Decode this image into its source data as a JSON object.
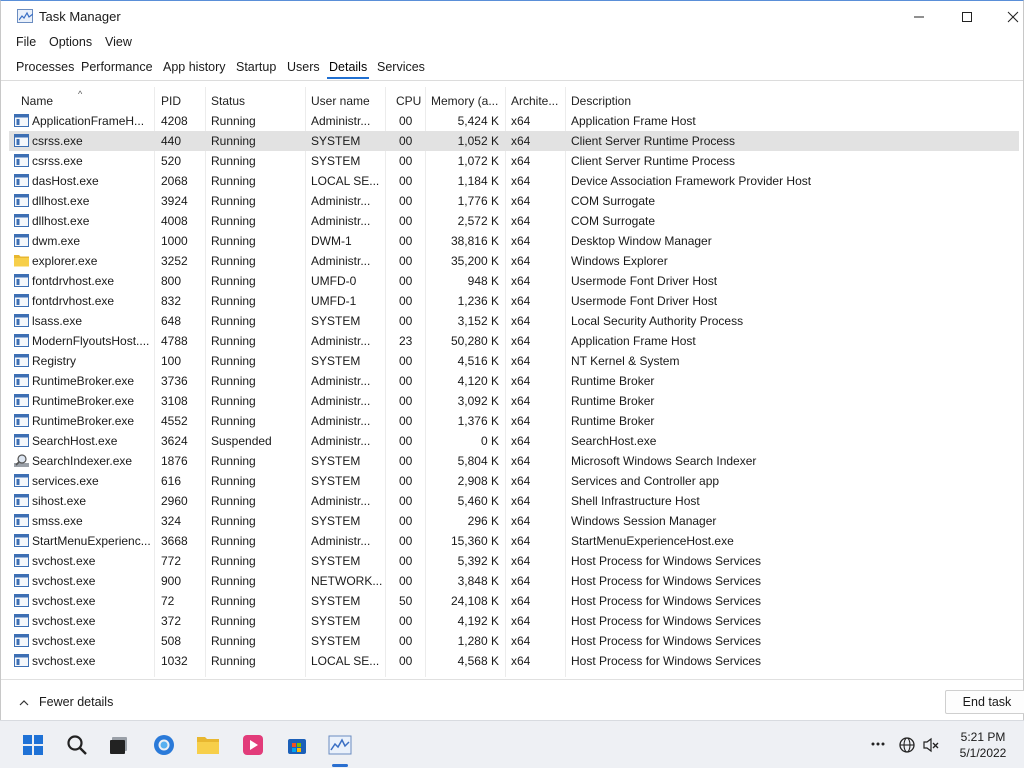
{
  "window": {
    "title": "Task Manager",
    "min_icon": "minimize-icon",
    "max_icon": "maximize-icon",
    "close_icon": "close-icon"
  },
  "menu": [
    "File",
    "Options",
    "View"
  ],
  "tabs": [
    "Processes",
    "Performance",
    "App history",
    "Startup",
    "Users",
    "Details",
    "Services"
  ],
  "active_tab": "Details",
  "columns": [
    "Name",
    "PID",
    "Status",
    "User name",
    "CPU",
    "Memory (a...",
    "Archite...",
    "Description"
  ],
  "rows": [
    {
      "name": "ApplicationFrameH...",
      "pid": "4208",
      "status": "Running",
      "user": "Administr...",
      "cpu": "00",
      "mem": "5,424 K",
      "arch": "x64",
      "desc": "Application Frame Host",
      "icon": "app"
    },
    {
      "name": "csrss.exe",
      "pid": "440",
      "status": "Running",
      "user": "SYSTEM",
      "cpu": "00",
      "mem": "1,052 K",
      "arch": "x64",
      "desc": "Client Server Runtime Process",
      "icon": "app"
    },
    {
      "name": "csrss.exe",
      "pid": "520",
      "status": "Running",
      "user": "SYSTEM",
      "cpu": "00",
      "mem": "1,072 K",
      "arch": "x64",
      "desc": "Client Server Runtime Process",
      "icon": "app"
    },
    {
      "name": "dasHost.exe",
      "pid": "2068",
      "status": "Running",
      "user": "LOCAL SE...",
      "cpu": "00",
      "mem": "1,184 K",
      "arch": "x64",
      "desc": "Device Association Framework Provider Host",
      "icon": "app"
    },
    {
      "name": "dllhost.exe",
      "pid": "3924",
      "status": "Running",
      "user": "Administr...",
      "cpu": "00",
      "mem": "1,776 K",
      "arch": "x64",
      "desc": "COM Surrogate",
      "icon": "app"
    },
    {
      "name": "dllhost.exe",
      "pid": "4008",
      "status": "Running",
      "user": "Administr...",
      "cpu": "00",
      "mem": "2,572 K",
      "arch": "x64",
      "desc": "COM Surrogate",
      "icon": "app"
    },
    {
      "name": "dwm.exe",
      "pid": "1000",
      "status": "Running",
      "user": "DWM-1",
      "cpu": "00",
      "mem": "38,816 K",
      "arch": "x64",
      "desc": "Desktop Window Manager",
      "icon": "app"
    },
    {
      "name": "explorer.exe",
      "pid": "3252",
      "status": "Running",
      "user": "Administr...",
      "cpu": "00",
      "mem": "35,200 K",
      "arch": "x64",
      "desc": "Windows Explorer",
      "icon": "folder"
    },
    {
      "name": "fontdrvhost.exe",
      "pid": "800",
      "status": "Running",
      "user": "UMFD-0",
      "cpu": "00",
      "mem": "948 K",
      "arch": "x64",
      "desc": "Usermode Font Driver Host",
      "icon": "app"
    },
    {
      "name": "fontdrvhost.exe",
      "pid": "832",
      "status": "Running",
      "user": "UMFD-1",
      "cpu": "00",
      "mem": "1,236 K",
      "arch": "x64",
      "desc": "Usermode Font Driver Host",
      "icon": "app"
    },
    {
      "name": "lsass.exe",
      "pid": "648",
      "status": "Running",
      "user": "SYSTEM",
      "cpu": "00",
      "mem": "3,152 K",
      "arch": "x64",
      "desc": "Local Security Authority Process",
      "icon": "app"
    },
    {
      "name": "ModernFlyoutsHost....",
      "pid": "4788",
      "status": "Running",
      "user": "Administr...",
      "cpu": "23",
      "mem": "50,280 K",
      "arch": "x64",
      "desc": "Application Frame Host",
      "icon": "app"
    },
    {
      "name": "Registry",
      "pid": "100",
      "status": "Running",
      "user": "SYSTEM",
      "cpu": "00",
      "mem": "4,516 K",
      "arch": "x64",
      "desc": "NT Kernel & System",
      "icon": "app"
    },
    {
      "name": "RuntimeBroker.exe",
      "pid": "3736",
      "status": "Running",
      "user": "Administr...",
      "cpu": "00",
      "mem": "4,120 K",
      "arch": "x64",
      "desc": "Runtime Broker",
      "icon": "app"
    },
    {
      "name": "RuntimeBroker.exe",
      "pid": "3108",
      "status": "Running",
      "user": "Administr...",
      "cpu": "00",
      "mem": "3,092 K",
      "arch": "x64",
      "desc": "Runtime Broker",
      "icon": "app"
    },
    {
      "name": "RuntimeBroker.exe",
      "pid": "4552",
      "status": "Running",
      "user": "Administr...",
      "cpu": "00",
      "mem": "1,376 K",
      "arch": "x64",
      "desc": "Runtime Broker",
      "icon": "app"
    },
    {
      "name": "SearchHost.exe",
      "pid": "3624",
      "status": "Suspended",
      "user": "Administr...",
      "cpu": "00",
      "mem": "0 K",
      "arch": "x64",
      "desc": "SearchHost.exe",
      "icon": "app"
    },
    {
      "name": "SearchIndexer.exe",
      "pid": "1876",
      "status": "Running",
      "user": "SYSTEM",
      "cpu": "00",
      "mem": "5,804 K",
      "arch": "x64",
      "desc": "Microsoft Windows Search Indexer",
      "icon": "search"
    },
    {
      "name": "services.exe",
      "pid": "616",
      "status": "Running",
      "user": "SYSTEM",
      "cpu": "00",
      "mem": "2,908 K",
      "arch": "x64",
      "desc": "Services and Controller app",
      "icon": "app"
    },
    {
      "name": "sihost.exe",
      "pid": "2960",
      "status": "Running",
      "user": "Administr...",
      "cpu": "00",
      "mem": "5,460 K",
      "arch": "x64",
      "desc": "Shell Infrastructure Host",
      "icon": "app"
    },
    {
      "name": "smss.exe",
      "pid": "324",
      "status": "Running",
      "user": "SYSTEM",
      "cpu": "00",
      "mem": "296 K",
      "arch": "x64",
      "desc": "Windows Session Manager",
      "icon": "app"
    },
    {
      "name": "StartMenuExperienc...",
      "pid": "3668",
      "status": "Running",
      "user": "Administr...",
      "cpu": "00",
      "mem": "15,360 K",
      "arch": "x64",
      "desc": "StartMenuExperienceHost.exe",
      "icon": "app"
    },
    {
      "name": "svchost.exe",
      "pid": "772",
      "status": "Running",
      "user": "SYSTEM",
      "cpu": "00",
      "mem": "5,392 K",
      "arch": "x64",
      "desc": "Host Process for Windows Services",
      "icon": "app"
    },
    {
      "name": "svchost.exe",
      "pid": "900",
      "status": "Running",
      "user": "NETWORK...",
      "cpu": "00",
      "mem": "3,848 K",
      "arch": "x64",
      "desc": "Host Process for Windows Services",
      "icon": "app"
    },
    {
      "name": "svchost.exe",
      "pid": "72",
      "status": "Running",
      "user": "SYSTEM",
      "cpu": "50",
      "mem": "24,108 K",
      "arch": "x64",
      "desc": "Host Process for Windows Services",
      "icon": "app"
    },
    {
      "name": "svchost.exe",
      "pid": "372",
      "status": "Running",
      "user": "SYSTEM",
      "cpu": "00",
      "mem": "4,192 K",
      "arch": "x64",
      "desc": "Host Process for Windows Services",
      "icon": "app"
    },
    {
      "name": "svchost.exe",
      "pid": "508",
      "status": "Running",
      "user": "SYSTEM",
      "cpu": "00",
      "mem": "1,280 K",
      "arch": "x64",
      "desc": "Host Process for Windows Services",
      "icon": "app"
    },
    {
      "name": "svchost.exe",
      "pid": "1032",
      "status": "Running",
      "user": "LOCAL SE...",
      "cpu": "00",
      "mem": "4,568 K",
      "arch": "x64",
      "desc": "Host Process for Windows Services",
      "icon": "app"
    }
  ],
  "selected_row": 1,
  "footer": {
    "fewer_details": "Fewer details",
    "end_task": "End task"
  },
  "taskbar": {
    "time": "5:21 PM",
    "date": "5/1/2022",
    "icons": [
      "start-icon",
      "search-icon",
      "task-view-icon",
      "browser-icon",
      "file-explorer-icon",
      "media-player-icon",
      "store-icon",
      "task-manager-icon"
    ]
  },
  "colors": {
    "accent": "#1f6fd1",
    "selected_row": "#e2e2e2",
    "taskbar": "#eef0f4"
  }
}
